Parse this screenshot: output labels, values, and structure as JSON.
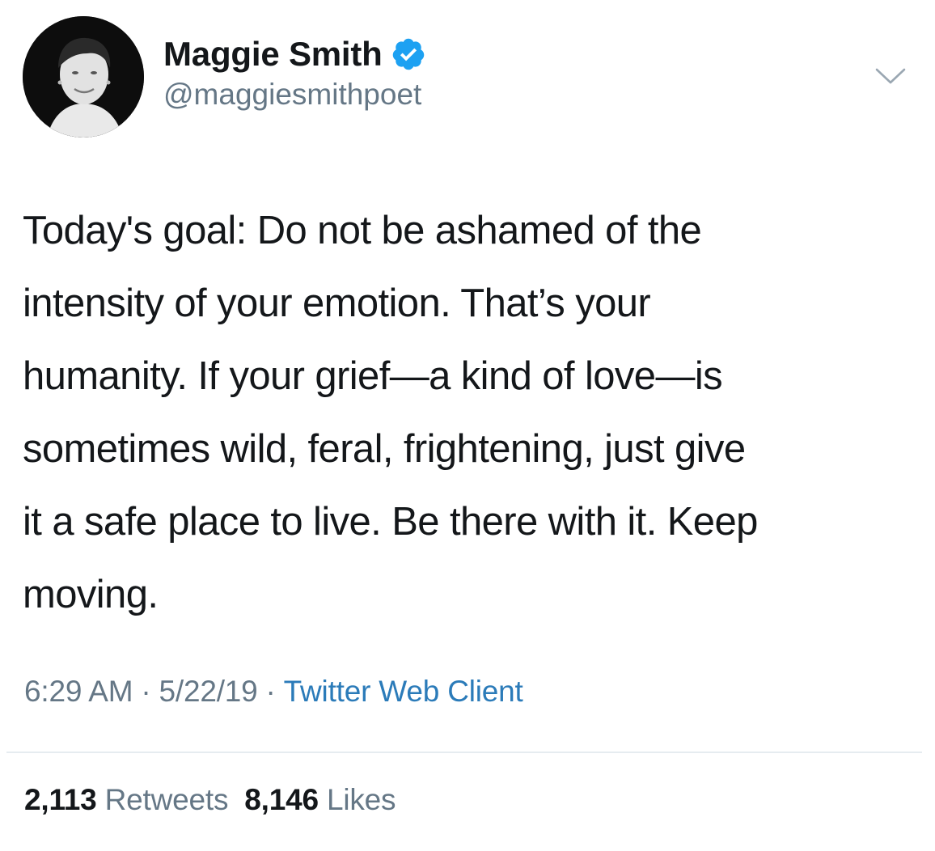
{
  "tweet": {
    "author": {
      "display_name": "Maggie Smith",
      "handle": "@maggiesmithpoet",
      "verified": true,
      "avatar": "profile-photo",
      "verified_icon": "verified-badge-icon"
    },
    "menu_icon": "chevron-down-icon",
    "lines": [
      "Today's goal: Do not be ashamed of the",
      "intensity of your emotion. That’s your",
      "humanity. If your grief—a kind of love—is",
      "sometimes wild, feral, frightening, just give",
      "it a safe place to live. Be there with it. Keep",
      "moving."
    ],
    "time": "6:29 AM",
    "separator": "·",
    "date": "5/22/19",
    "source": "Twitter Web Client",
    "retweets_count": "2,113",
    "retweets_label": "Retweets",
    "likes_count": "8,146",
    "likes_label": "Likes"
  },
  "colors": {
    "text": "#14171a",
    "secondary": "#657786",
    "link": "#2b7bb9",
    "verified": "#1da1f2",
    "divider": "#e6ecf0"
  }
}
